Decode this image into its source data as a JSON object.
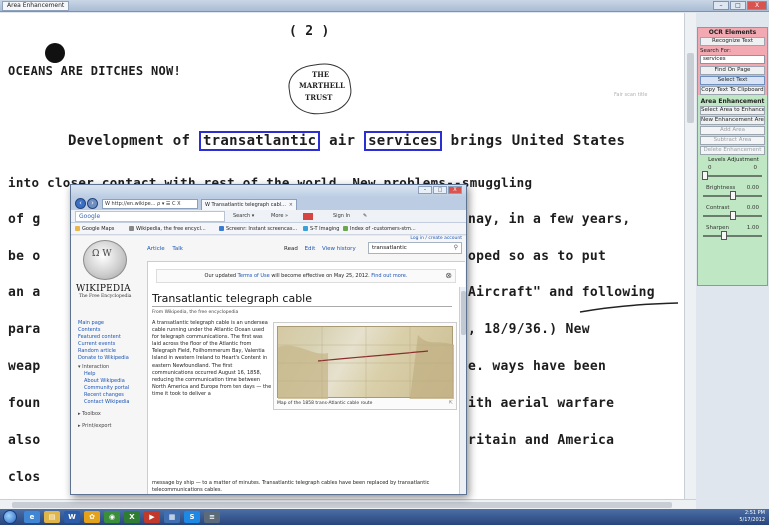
{
  "app": {
    "title": "Area Enhancement",
    "win_minimize": "–",
    "win_maximize": "□",
    "win_close": "X"
  },
  "document": {
    "page_number": "( 2 )",
    "heading": "OCEANS ARE DITCHES NOW!",
    "stamp": [
      "THE",
      "MARTHELL",
      "TRUST"
    ],
    "line1_prefix": "Development of",
    "line1_word1": "transatlantic",
    "line1_mid": "air",
    "line1_word2": "services",
    "line1_suffix": "brings United States",
    "line2": "into closer contact with rest of the world.  New problems--smuggling",
    "line3_left": "of g",
    "line3_right": "nay, in a few years,",
    "line4_left": "be o",
    "line4_right": "oped so as to put",
    "line5_left": "an a",
    "line5_right": "Aircraft\" and following",
    "line6_left": "para",
    "line6_right": ", 18/9/36.)  New",
    "line7_left": "weap",
    "line7_right": "e.  ways have been",
    "line8_left": "foun",
    "line8_right": "ith aerial warfare",
    "line9_left": "also",
    "line9_right": "ritain and America",
    "line10_left": "clos",
    "faint_text": "Fair scan title"
  },
  "ocr_panel": {
    "title": "OCR Elements",
    "recognize": "Recognize Text",
    "search_label": "Search For:",
    "search_value": "services",
    "find": "Find On Page",
    "select": "Select Text",
    "copy": "Copy Text To Clipboard"
  },
  "area_panel": {
    "title": "Area Enhancement",
    "select_area": "Select Area to Enhance",
    "new_area": "New Enhancement Area",
    "add_area": "Add Area",
    "subtract_area": "Subtract Area",
    "delete": "Delete Enhancement",
    "levels_label": "Levels Adjustment",
    "levels_low": "0",
    "levels_high": "0",
    "sliders": [
      {
        "label": "Brightness",
        "value": "0.00",
        "pos": 0.5
      },
      {
        "label": "Contrast",
        "value": "0.00",
        "pos": 0.5
      },
      {
        "label": "Sharpen",
        "value": "1.00",
        "pos": 0.35
      }
    ]
  },
  "browser": {
    "address": "W http://en.wikipe... ρ ▾ ☰ C X",
    "tab_title": "W Transatlantic telegraph cabl...",
    "tab_close": "×",
    "google": "Google",
    "cmd_search": "Search ▾",
    "cmd_more": "More »",
    "cmd_signin": "Sign In",
    "favorites": [
      "Google Maps",
      "Wikipedia, the free encycl...",
      "Screenr: Instant screencas...",
      "S-T Imaging",
      "Index of -customers-stm..."
    ]
  },
  "wiki": {
    "wordmark": "WIKIPEDIA",
    "tagline": "The Free Encyclopedia",
    "login": "Log in / create account",
    "tab_article": "Article",
    "tab_talk": "Talk",
    "tab_read": "Read",
    "tab_edit": "Edit",
    "tab_history": "View history",
    "search_value": "transatlantic",
    "side_main": [
      "Main page",
      "Contents",
      "Featured content",
      "Current events",
      "Random article",
      "Donate to Wikipedia"
    ],
    "side_interaction_head": "▾ Interaction",
    "side_interaction": [
      "Help",
      "About Wikipedia",
      "Community portal",
      "Recent changes",
      "Contact Wikipedia"
    ],
    "side_toolbox": "▸ Toolbox",
    "side_print": "▸ Print/export",
    "notice_pre": "Our updated ",
    "notice_link": "Terms of Use",
    "notice_mid": " will become effective on May 25, 2012. ",
    "notice_link2": "Find out more.",
    "title": "Transatlantic telegraph cable",
    "from": "From Wikipedia, the free encyclopedia",
    "body": "A transatlantic telegraph cable is an undersea cable running under the Atlantic Ocean used for telegraph communications. The first was laid across the floor of the Atlantic from Telegraph Field, Foilhommerum Bay, Valentia Island in western Ireland to Heart's Content in eastern Newfoundland. The first communications occurred August 16, 1858, reducing the communication time between North America and Europe from ten days — the time it took to deliver a",
    "footer": "message by ship — to a matter of minutes. Transatlantic telegraph cables have been replaced by transatlantic telecommunications cables.",
    "map_caption": "Map of the 1858 trans-Atlantic cable route"
  },
  "taskbar": {
    "time": "2:51 PM",
    "date": "5/17/2012"
  }
}
